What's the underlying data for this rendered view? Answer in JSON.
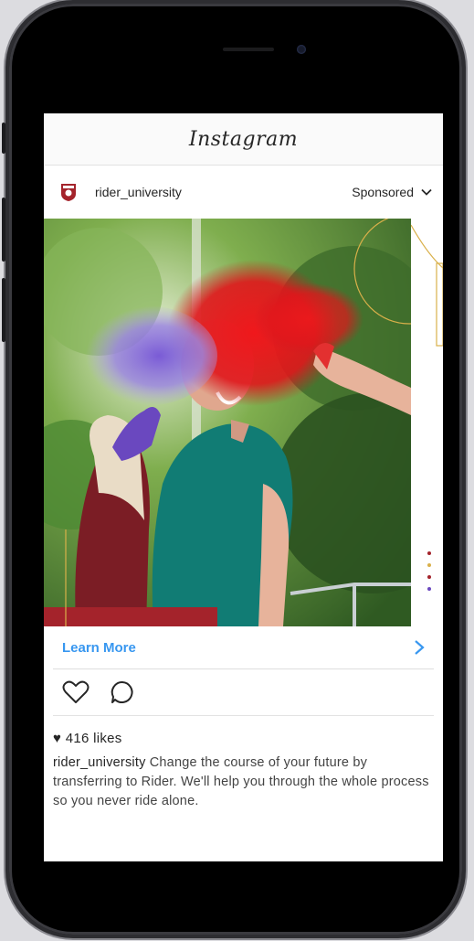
{
  "header": {
    "logo_text": "Instagram"
  },
  "post": {
    "username": "rider_university",
    "sponsored_label": "Sponsored",
    "cta_label": "Learn More",
    "likes_text": "416 likes",
    "caption_user": "rider_university",
    "caption_text": "Change the course of your future by transferring to Rider. We'll help you through the whole process so you never ride alone."
  },
  "icons": [
    "heart-icon",
    "comment-icon",
    "chevron-down-icon",
    "chevron-right-icon"
  ],
  "colors": {
    "cta": "#3897f0",
    "brand_red": "#a4232b"
  }
}
